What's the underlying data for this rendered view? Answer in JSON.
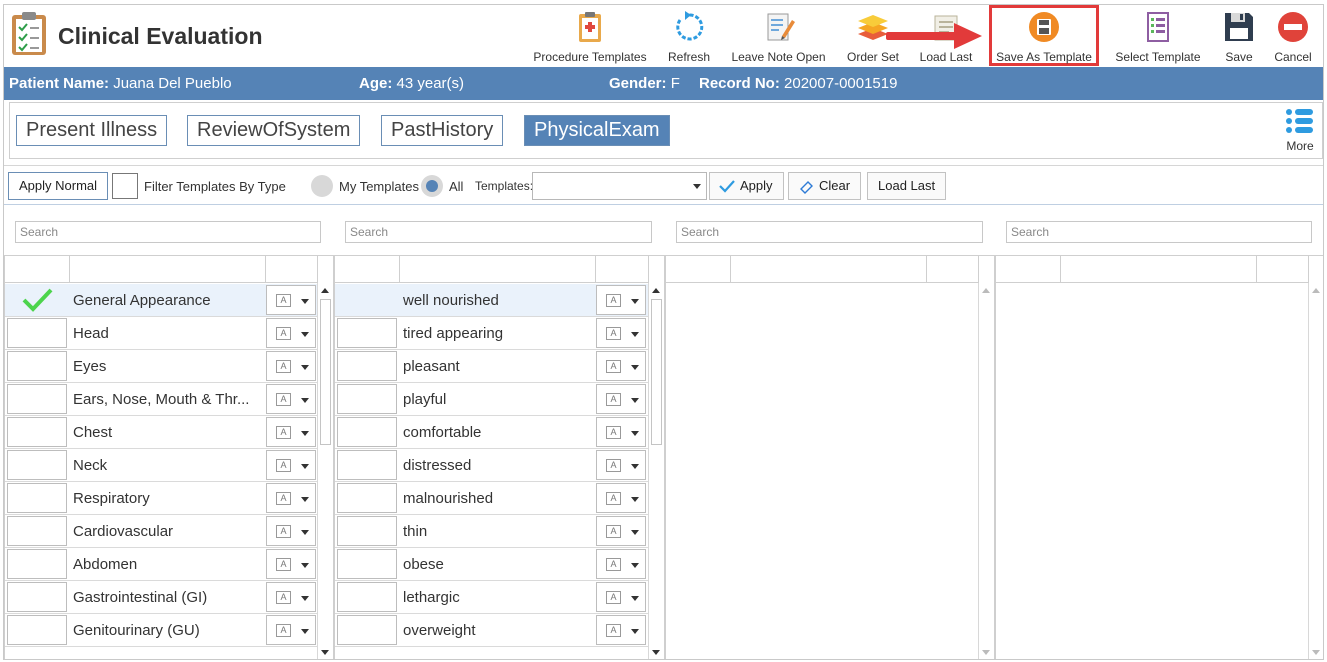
{
  "app": {
    "title": "Clinical Evaluation"
  },
  "toolbar": {
    "items": [
      {
        "label": "Procedure Templates",
        "icon": "clipboard-plus-icon"
      },
      {
        "label": "Refresh",
        "icon": "refresh-icon"
      },
      {
        "label": "Leave Note Open",
        "icon": "note-pencil-icon"
      },
      {
        "label": "Order Set",
        "icon": "layers-icon"
      },
      {
        "label": "Load Last",
        "icon": "document-icon"
      },
      {
        "label": "Save As Template",
        "icon": "save-template-icon"
      },
      {
        "label": "Select Template",
        "icon": "checklist-icon"
      },
      {
        "label": "Save",
        "icon": "floppy-disk-icon"
      },
      {
        "label": "Cancel",
        "icon": "cancel-icon"
      }
    ]
  },
  "patient": {
    "name_label": "Patient Name:",
    "name": "Juana Del Pueblo",
    "age_label": "Age:",
    "age": "43 year(s)",
    "gender_label": "Gender:",
    "gender": "F",
    "record_label": "Record No:",
    "record": "202007-0001519"
  },
  "tabs": [
    {
      "label": "Present Illness",
      "active": false
    },
    {
      "label": "ReviewOfSystem",
      "active": false
    },
    {
      "label": "PastHistory",
      "active": false
    },
    {
      "label": "PhysicalExam",
      "active": true
    }
  ],
  "more": {
    "label": "More"
  },
  "filter": {
    "apply_normal": "Apply Normal",
    "filter_by_type": "Filter Templates By Type",
    "my_templates": "My Templates",
    "all": "All",
    "templates_label": "Templates:",
    "templates_value": "",
    "apply": "Apply",
    "clear": "Clear",
    "load_last": "Load Last"
  },
  "search": {
    "placeholder": "Search"
  },
  "systems": [
    "General Appearance",
    "Head",
    "Eyes",
    "Ears, Nose, Mouth & Thr...",
    "Chest",
    "Neck",
    "Respiratory",
    "Cardiovascular",
    "Abdomen",
    "Gastrointestinal (GI)",
    "Genitourinary (GU)"
  ],
  "findings": [
    "well nourished",
    "tired appearing",
    "pleasant",
    "playful",
    "comfortable",
    "distressed",
    "malnourished",
    "thin",
    "obese",
    "lethargic",
    "overweight"
  ],
  "colors": {
    "accent": "#5583b6",
    "highlight": "#e23a3a",
    "check": "#4cd44c"
  }
}
